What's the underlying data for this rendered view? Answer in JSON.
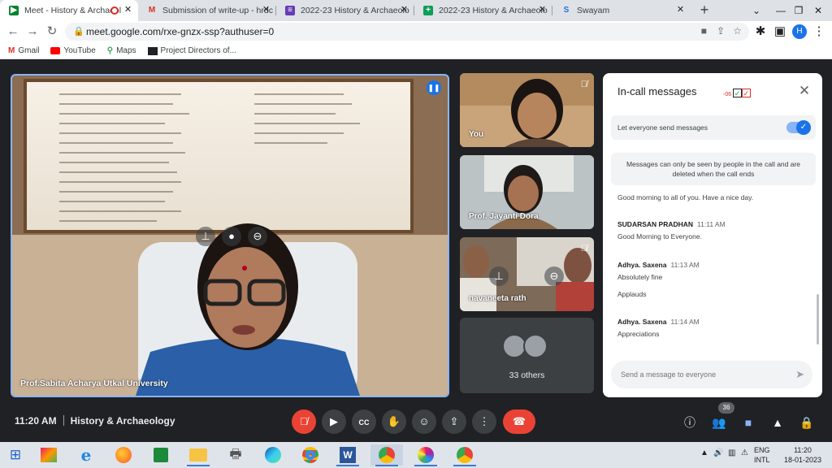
{
  "browser": {
    "tabs": [
      {
        "title": "Meet - History & Archaeol",
        "favicon": "meet-icon",
        "active": true,
        "recording": true
      },
      {
        "title": "Submission of write-up - hrdc",
        "favicon": "gmail-icon",
        "active": false
      },
      {
        "title": "2022-23 History & Archaeolo",
        "favicon": "forms-icon",
        "active": false
      },
      {
        "title": "2022-23 History & Archaeolo",
        "favicon": "sheets-icon",
        "active": false
      },
      {
        "title": "Swayam",
        "favicon": "swayam-icon",
        "active": false
      }
    ],
    "url": "meet.google.com/rxe-gnzx-ssp?authuser=0",
    "profile_initial": "H",
    "bookmarks": [
      {
        "label": "Gmail",
        "icon": "gmail-icon"
      },
      {
        "label": "YouTube",
        "icon": "youtube-icon"
      },
      {
        "label": "Maps",
        "icon": "maps-icon"
      },
      {
        "label": "Project Directors of...",
        "icon": "bookmark-site-icon"
      }
    ]
  },
  "meet": {
    "main_speaker": "Prof.Sabita Acharya Utkal University",
    "tiles": [
      {
        "name": "You",
        "muted": true
      },
      {
        "name": "Prof. Jayanti Dora",
        "muted": false
      },
      {
        "name": "navaneeta rath",
        "muted": true
      }
    ],
    "others_label": "33 others",
    "time": "11:20 AM",
    "meeting_name": "History & Archaeology",
    "participants_count": "36"
  },
  "chat": {
    "title": "In-call messages",
    "header_badge": "-06",
    "toggle_label": "Let everyone send messages",
    "toggle_on": true,
    "info": "Messages can only be seen by people in the call and are deleted when the call ends",
    "messages": [
      {
        "text": "Good morning to all of you. Have a nice day."
      },
      {
        "sender": "SUDARSAN PRADHAN",
        "time": "11:11 AM",
        "text": "Good Morning to Everyone."
      },
      {
        "sender": "Adhya. Saxena",
        "time": "11:13 AM",
        "text": "Absolutely fine",
        "text2": "Applauds"
      },
      {
        "sender": "Adhya. Saxena",
        "time": "11:14 AM",
        "text": "Appreciations"
      }
    ],
    "input_placeholder": "Send a message to everyone"
  },
  "taskbar": {
    "lang_line1": "ENG",
    "lang_line2": "INTL",
    "clock_time": "11:20",
    "clock_date": "18-01-2023"
  },
  "colors": {
    "accent": "#1a73e8",
    "end_call": "#ea4335",
    "meet_bg": "#202124",
    "active_border": "#8ab4f8"
  }
}
